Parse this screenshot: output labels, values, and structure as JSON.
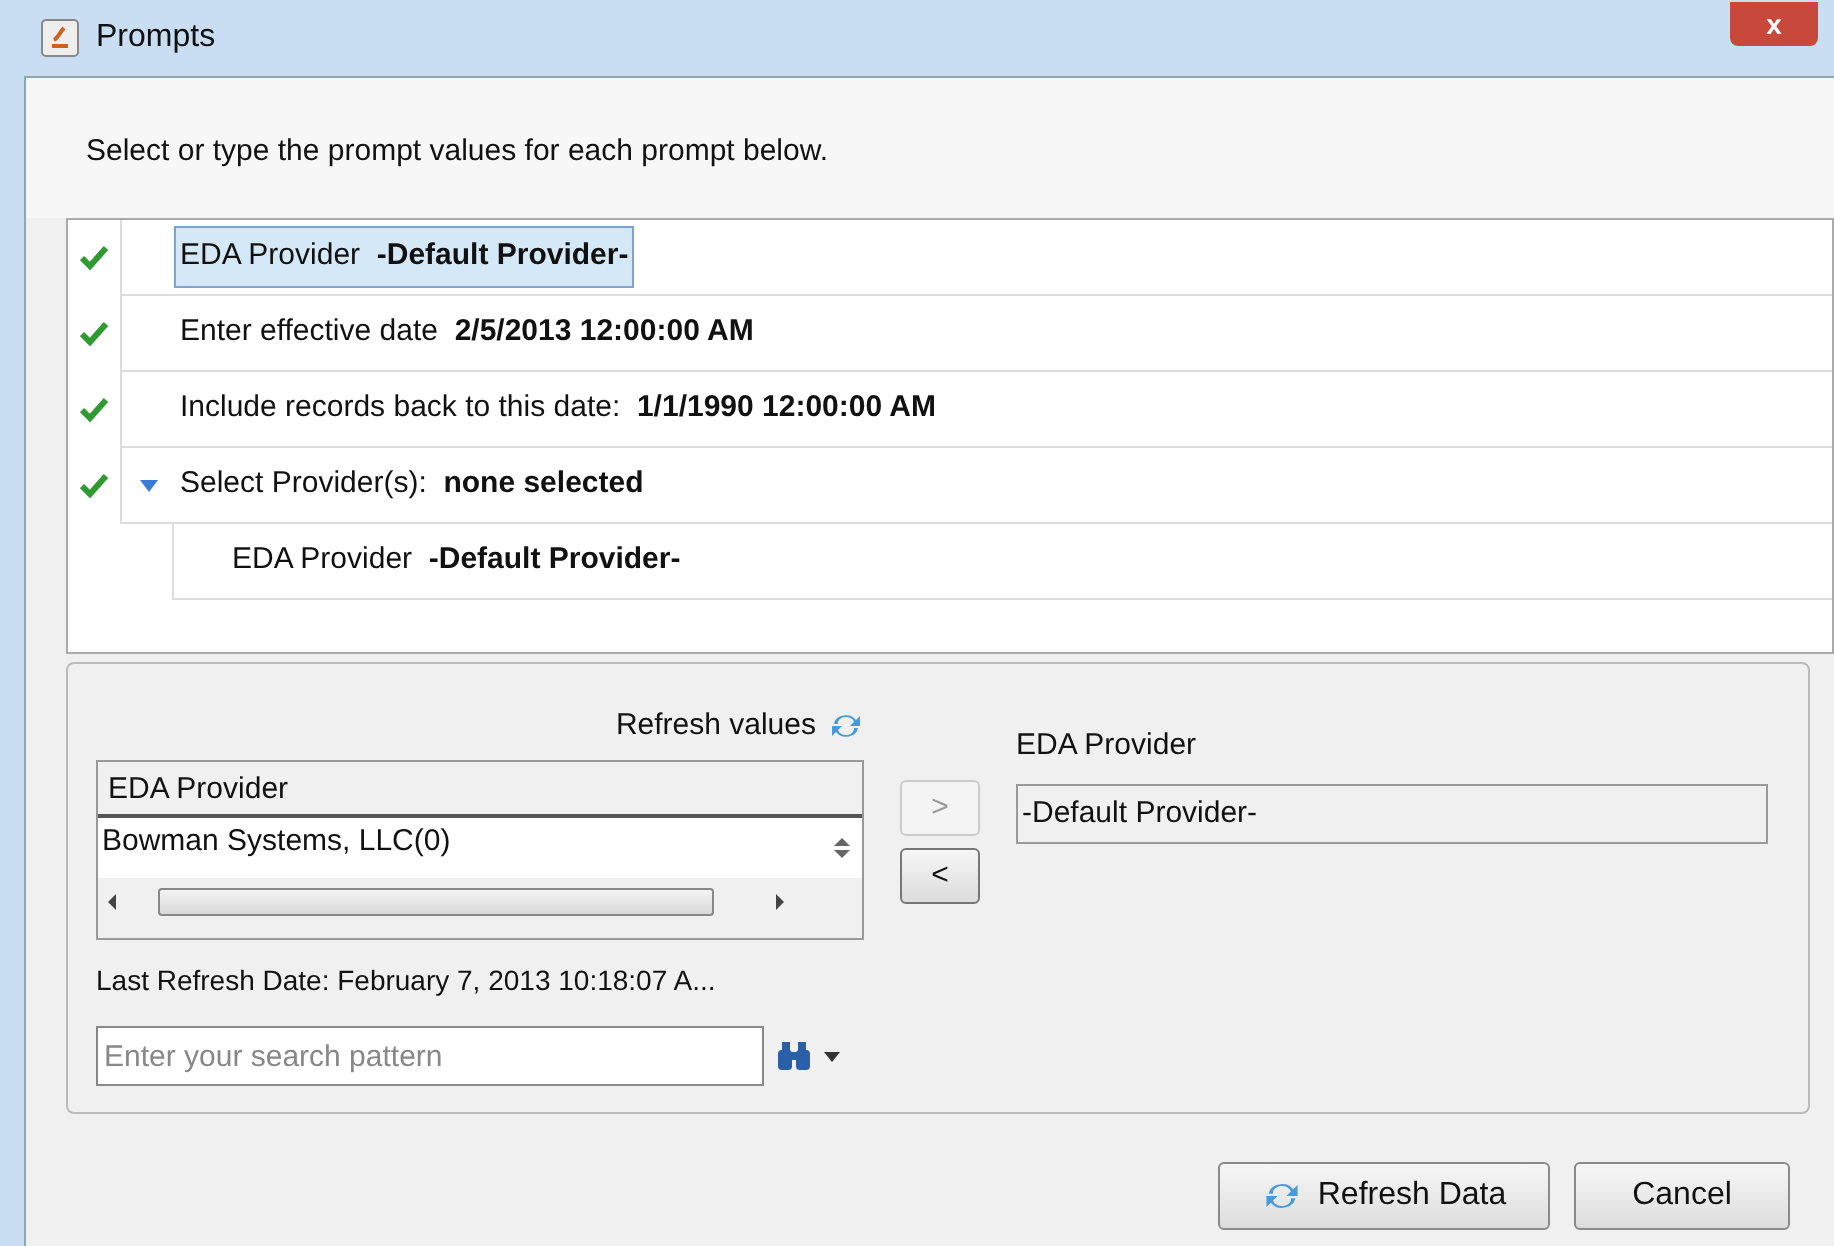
{
  "window": {
    "title": "Prompts",
    "close": "x"
  },
  "instruction": "Select or type the prompt values for each prompt below.",
  "prompts": [
    {
      "label": "EDA Provider",
      "value": "-Default Provider-",
      "checked": true,
      "selected": true
    },
    {
      "label": "Enter effective date",
      "value": "2/5/2013 12:00:00 AM",
      "checked": true,
      "selected": false
    },
    {
      "label": "Include records back to this date:",
      "value": "1/1/1990 12:00:00 AM",
      "checked": true,
      "selected": false
    },
    {
      "label": "Select Provider(s):",
      "value": "none selected",
      "checked": true,
      "selected": false,
      "expanded": true,
      "children": [
        {
          "label": "EDA Provider",
          "value": "-Default Provider-",
          "selected": false
        }
      ]
    }
  ],
  "editor": {
    "refresh_label": "Refresh values",
    "list_header": "EDA Provider",
    "list_items": [
      "Bowman Systems, LLC(0)"
    ],
    "add_button": ">",
    "remove_button": "<",
    "add_disabled": true,
    "selected_label": "EDA Provider",
    "selected_value": "-Default Provider-",
    "last_refresh": "Last Refresh Date: February 7, 2013 10:18:07 A...",
    "search": {
      "placeholder": "Enter your search pattern"
    }
  },
  "buttons": [
    {
      "label": "Refresh Data",
      "kind": "refresh"
    },
    {
      "label": "Cancel",
      "kind": "plain"
    }
  ]
}
